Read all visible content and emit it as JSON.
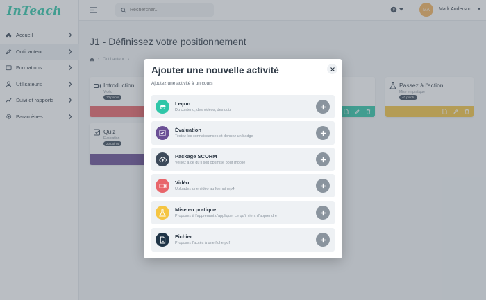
{
  "app": {
    "logo": "InTeach"
  },
  "sidebar": {
    "items": [
      {
        "label": "Accueil",
        "icon": "home-icon"
      },
      {
        "label": "Outil auteur",
        "icon": "pencil-icon",
        "active": true
      },
      {
        "label": "Formations",
        "icon": "folder-icon"
      },
      {
        "label": "Utilisateurs",
        "icon": "user-icon"
      },
      {
        "label": "Suivi et rapports",
        "icon": "chart-icon"
      },
      {
        "label": "Paramètres",
        "icon": "gear-icon"
      }
    ]
  },
  "topbar": {
    "search_placeholder": "Rechercher...",
    "avatar_initials": "MA",
    "user_name": "Mark Anderson",
    "avatar_color": "#f4b45e"
  },
  "main": {
    "title": "J1 - Définissez votre positionnement",
    "breadcrumb": [
      "Outil auteur"
    ],
    "cards": [
      {
        "title": "Introduction",
        "subtitle": "Vidéo",
        "points": "10 points",
        "icon": "video-icon",
        "color": "#e8656a"
      },
      {
        "title": "Quiz",
        "subtitle": "Évaluation",
        "points": "20 points",
        "icon": "checkbox-icon",
        "color": "#6a4f95"
      },
      {
        "title": "Passez à l'action",
        "subtitle": "Mise en pratique",
        "points": "40 points",
        "icon": "flask-icon",
        "color": "#f5c542"
      },
      {
        "title": "",
        "color": "#2fc6a8"
      }
    ]
  },
  "modal": {
    "title": "Ajouter une nouvelle activité",
    "subtitle": "Ajoutez une activité à un cours",
    "activities": [
      {
        "title": "Leçon",
        "desc": "Du contenu, des vidéos, des quiz",
        "icon": "graduation-cap-icon",
        "color": "#2fc6a8"
      },
      {
        "title": "Évaluation",
        "desc": "Testez les connaissances et donnez un badge",
        "icon": "checkbox-icon",
        "color": "#6a4f95"
      },
      {
        "title": "Package SCORM",
        "desc": "Veillez à ce qu'il soit optimisé pour mobile",
        "icon": "cloud-upload-icon",
        "color": "#3d4a5a"
      },
      {
        "title": "Vidéo",
        "desc": "Uploadez une vidéo au format mp4",
        "icon": "video-icon",
        "color": "#e8656a"
      },
      {
        "title": "Mise en pratique",
        "desc": "Proposez à l'apprenant d'appliquer ce qu'il vient d'apprendre",
        "icon": "flask-icon",
        "color": "#f5c542"
      },
      {
        "title": "Fichier",
        "desc": "Proposez l'accès à une fiche pdf",
        "icon": "file-icon",
        "color": "#1f3447"
      }
    ]
  }
}
